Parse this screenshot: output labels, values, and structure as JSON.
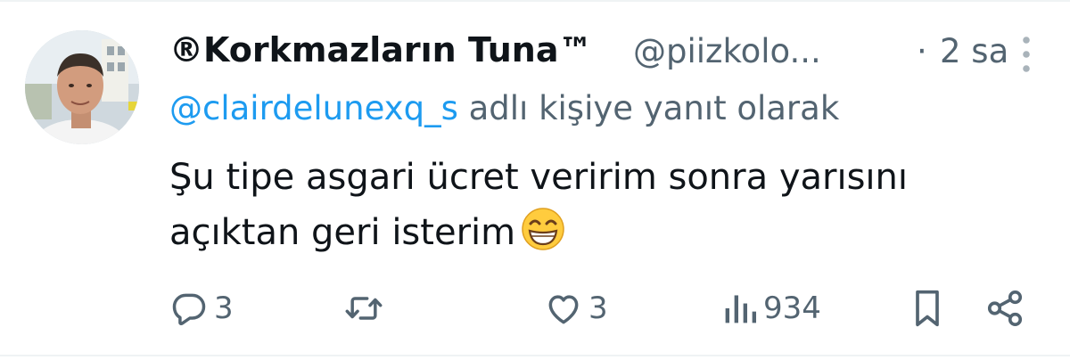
{
  "tweet": {
    "display_name": "®Korkmazların Tuna™",
    "handle": "@piizkolo...",
    "separator": "·",
    "time": "2 sa",
    "reply_to": {
      "mention": "@clairdelunexq_s",
      "suffix": " adlı kişiye yanıt olarak"
    },
    "text_line1": "Şu tipe asgari ücret veririm sonra yarısını",
    "text_line2": "açıktan geri isterim",
    "emoji": "grinning-face-with-smiling-eyes"
  },
  "actions": {
    "reply_count": "3",
    "like_count": "3",
    "views_count": "934"
  },
  "colors": {
    "text": "#0f1419",
    "secondary": "#536471",
    "link": "#1d9bf0",
    "divider": "#eff3f4"
  },
  "icons": [
    "reply-icon",
    "retweet-icon",
    "like-icon",
    "views-icon",
    "bookmark-icon",
    "share-icon",
    "more-icon"
  ]
}
